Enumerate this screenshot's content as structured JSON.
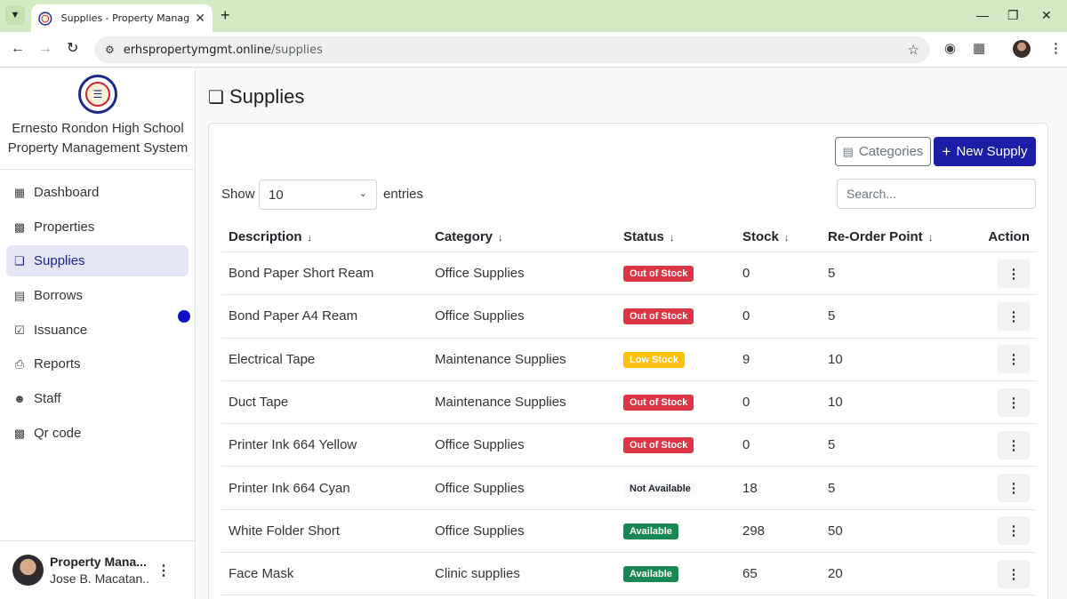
{
  "browser": {
    "tab_title": "Supplies - Property Management",
    "url_host": "erhspropertymgmt.online",
    "url_path": "/supplies"
  },
  "sidebar": {
    "school_line1": "Ernesto Rondon High School",
    "school_line2": "Property Management System",
    "items": [
      {
        "label": "Dashboard",
        "icon": "dashboard-icon"
      },
      {
        "label": "Properties",
        "icon": "building-icon"
      },
      {
        "label": "Supplies",
        "icon": "box-icon"
      },
      {
        "label": "Borrows",
        "icon": "card-icon"
      },
      {
        "label": "Issuance",
        "icon": "document-check-icon"
      },
      {
        "label": "Reports",
        "icon": "printer-icon"
      },
      {
        "label": "Staff",
        "icon": "users-icon"
      },
      {
        "label": "Qr code",
        "icon": "qr-code-icon"
      }
    ],
    "active_item": "Supplies",
    "user_role": "Property Mana...",
    "user_name": "Jose B. Macatan..."
  },
  "main": {
    "title": "Supplies",
    "categories_button": "Categories",
    "new_button": "New Supply",
    "show_label": "Show",
    "entries_value": "10",
    "entries_label": "entries",
    "search_placeholder": "Search..."
  },
  "table": {
    "columns": [
      "Description",
      "Category",
      "Status",
      "Stock",
      "Re-Order Point",
      "Action"
    ],
    "rows": [
      {
        "description": "Bond Paper Short Ream",
        "category": "Office Supplies",
        "status": "Out of Stock",
        "stock": "0",
        "reorder": "5"
      },
      {
        "description": "Bond Paper A4 Ream",
        "category": "Office Supplies",
        "status": "Out of Stock",
        "stock": "0",
        "reorder": "5"
      },
      {
        "description": "Electrical Tape",
        "category": "Maintenance Supplies",
        "status": "Low Stock",
        "stock": "9",
        "reorder": "10"
      },
      {
        "description": "Duct Tape",
        "category": "Maintenance Supplies",
        "status": "Out of Stock",
        "stock": "0",
        "reorder": "10"
      },
      {
        "description": "Printer Ink 664 Yellow",
        "category": "Office Supplies",
        "status": "Out of Stock",
        "stock": "0",
        "reorder": "5"
      },
      {
        "description": "Printer Ink 664 Cyan",
        "category": "Office Supplies",
        "status": "Not Available",
        "stock": "18",
        "reorder": "5"
      },
      {
        "description": "White Folder Short",
        "category": "Office Supplies",
        "status": "Available",
        "stock": "298",
        "reorder": "50"
      },
      {
        "description": "Face Mask",
        "category": "Clinic supplies",
        "status": "Available",
        "stock": "65",
        "reorder": "20"
      }
    ]
  },
  "colors": {
    "primary": "#1b1fa8",
    "out_of_stock": "#dc3545",
    "low_stock": "#ffc107",
    "available": "#198754",
    "tab_bar": "#d3ebc5"
  }
}
